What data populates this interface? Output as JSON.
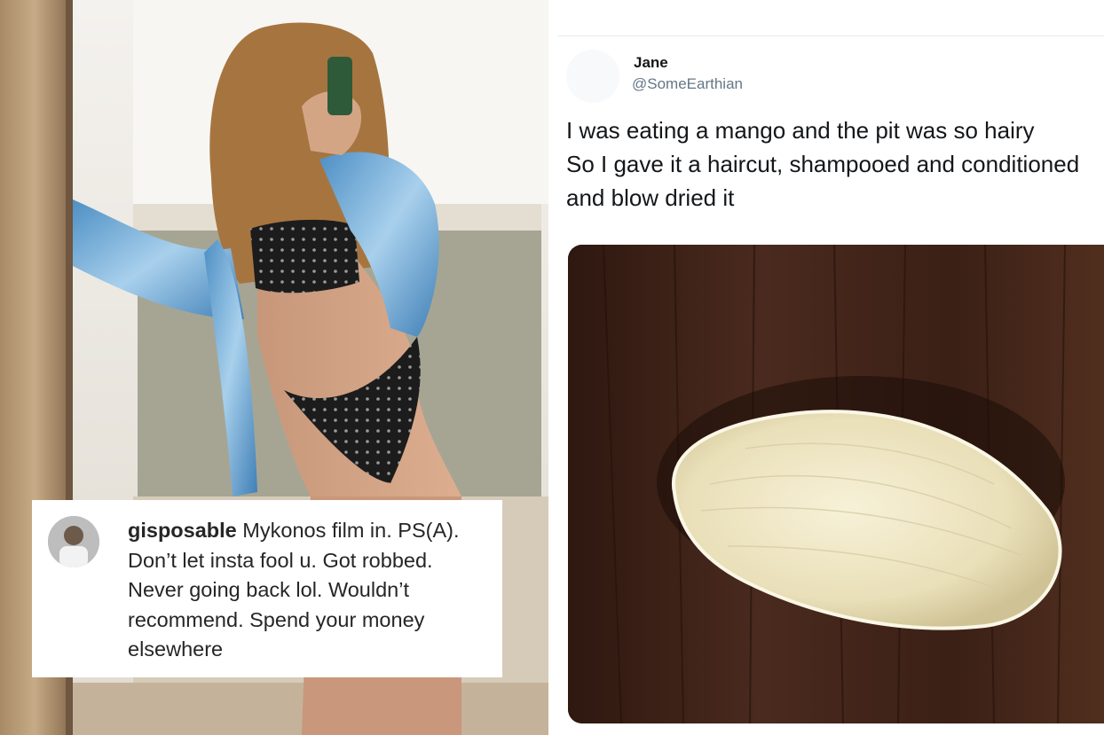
{
  "instagram_comment": {
    "username": "gisposable",
    "text": " Mykonos film in. PS(A). Don’t let insta fool u. Got robbed. Never going back lol. Wouldn’t recommend. Spend your money elsewhere"
  },
  "tweet": {
    "author_name": "Jane",
    "author_handle": "@SomeEarthian",
    "text_lines": [
      "I was eating a mango and the pit was so hairy",
      "So I gave it a haircut, shampooed and conditioned",
      "and blow dried it"
    ]
  },
  "colors": {
    "twitter_text": "#14171a",
    "twitter_handle": "#657786",
    "instagram_text": "#262626",
    "wood_dark": "#3a1f16"
  },
  "icons": [
    "user-avatar-icon",
    "profile-avatar-icon"
  ]
}
